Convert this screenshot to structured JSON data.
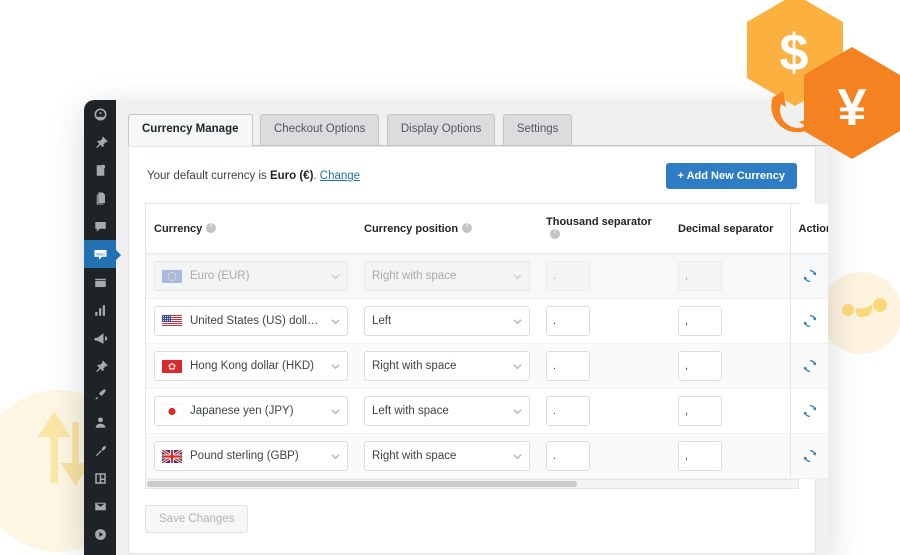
{
  "window": {
    "tabs": [
      {
        "label": "Currency Manage",
        "active": true
      },
      {
        "label": "Checkout Options",
        "active": false
      },
      {
        "label": "Display Options",
        "active": false
      },
      {
        "label": "Settings",
        "active": false
      }
    ]
  },
  "sidebar": {
    "items": [
      {
        "name": "dashboard-icon",
        "active": false
      },
      {
        "name": "pin-icon",
        "active": false
      },
      {
        "name": "media-icon",
        "active": false
      },
      {
        "name": "pages-icon",
        "active": false
      },
      {
        "name": "comments-icon",
        "active": false
      },
      {
        "name": "woocommerce-icon",
        "active": true
      },
      {
        "name": "products-icon",
        "active": false
      },
      {
        "name": "analytics-icon",
        "active": false
      },
      {
        "name": "marketing-icon",
        "active": false
      },
      {
        "name": "plugins-icon",
        "active": false
      },
      {
        "name": "appearance-icon",
        "active": false
      },
      {
        "name": "users-icon",
        "active": false
      },
      {
        "name": "tools-icon",
        "active": false
      },
      {
        "name": "settings-icon",
        "active": false
      },
      {
        "name": "mail-icon",
        "active": false
      },
      {
        "name": "play-icon",
        "active": false
      }
    ]
  },
  "panel": {
    "default_currency_prefix": "Your default currency is ",
    "default_currency_name": "Euro (€)",
    "default_currency_suffix": ". ",
    "change_link": "Change",
    "add_button": "+ Add New Currency",
    "save_button": "Save Changes"
  },
  "table": {
    "headers": {
      "currency": "Currency",
      "position": "Currency position",
      "thousand": "Thousand separator",
      "decimal": "Decimal separator",
      "action": "Action"
    },
    "rows": [
      {
        "flag": "eu-flag",
        "currency": "Euro (EUR)",
        "position": "Right with space",
        "thousand": ".",
        "decimal": ",",
        "disabled": true
      },
      {
        "flag": "us-flag",
        "currency": "United States (US) dollar...",
        "position": "Left",
        "thousand": ".",
        "decimal": ",",
        "disabled": false
      },
      {
        "flag": "hk-flag",
        "currency": "Hong Kong dollar (HKD)",
        "position": "Right with space",
        "thousand": ".",
        "decimal": ",",
        "disabled": false
      },
      {
        "flag": "jp-flag",
        "currency": "Japanese yen (JPY)",
        "position": "Left with space",
        "thousand": ".",
        "decimal": ",",
        "disabled": false
      },
      {
        "flag": "gb-flag",
        "currency": "Pound sterling (GBP)",
        "position": "Right with space",
        "thousand": ".",
        "decimal": ",",
        "disabled": false
      }
    ]
  },
  "decorations": {
    "hex_dollar_symbol": "$",
    "hex_yen_symbol": "¥",
    "hex_dollar_color": "#fbb040",
    "hex_yen_color": "#f58220",
    "exchange_arrow_color": "#f58220",
    "blob_color": "#fdf5e0"
  },
  "colors": {
    "accent_blue": "#2e7cc4",
    "link_blue": "#2271b1",
    "delete_red": "#e02b20",
    "sidebar_bg": "#1d2327"
  }
}
